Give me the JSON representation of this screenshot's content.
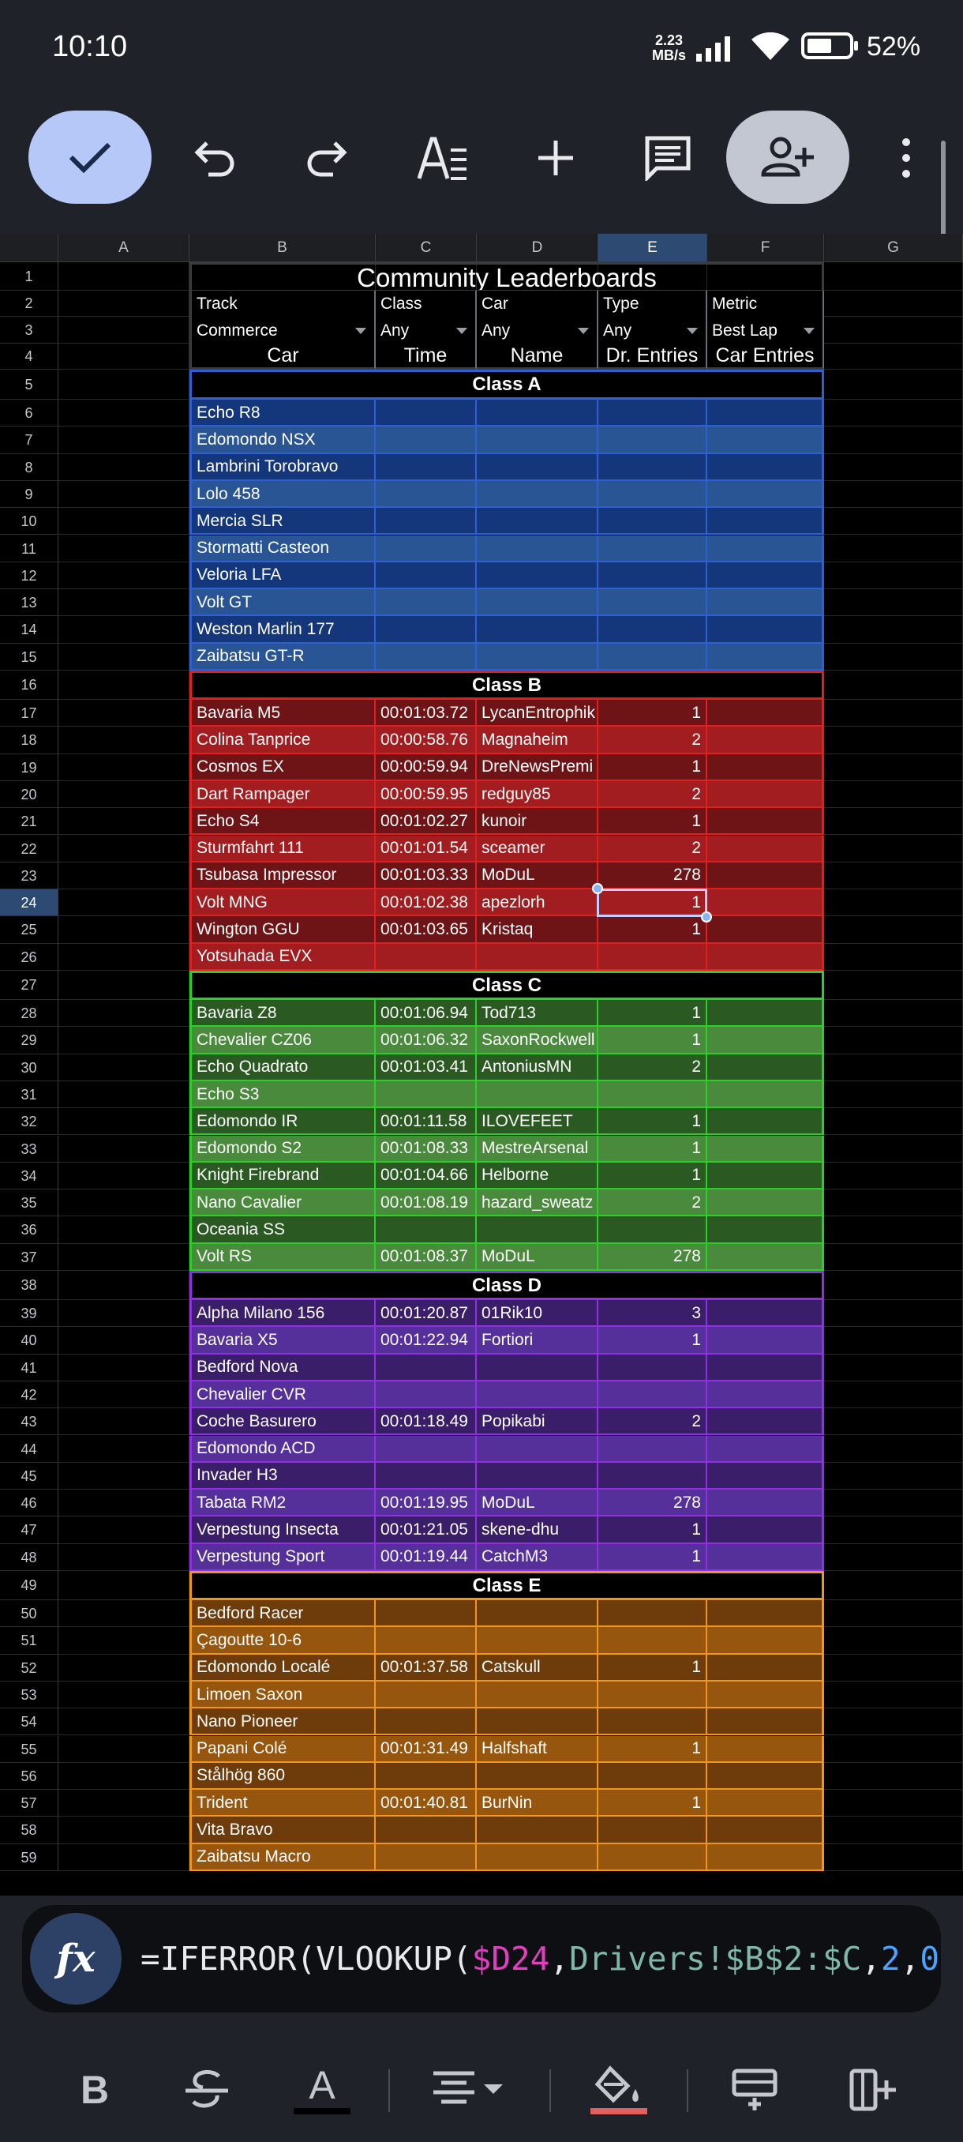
{
  "status_bar": {
    "time": "10:10",
    "net_speed": "2.23",
    "net_unit": "MB/s",
    "battery": "52%"
  },
  "toolbar": {
    "icons": [
      "check-icon",
      "undo-icon",
      "redo-icon",
      "text-format-icon",
      "insert-plus-icon",
      "comment-icon",
      "add-person-icon",
      "more-vert-icon"
    ]
  },
  "columns": [
    "A",
    "B",
    "C",
    "D",
    "E",
    "F",
    "G"
  ],
  "selected_column": "E",
  "selected_row": 24,
  "sheet": {
    "title": "Community Leaderboards",
    "filter_labels": [
      "Track",
      "Class",
      "Car",
      "Type",
      "Metric"
    ],
    "filter_values": [
      "Commerce",
      "Any",
      "Any",
      "Any",
      "Best Lap"
    ],
    "table_headers": [
      "Car",
      "Time",
      "Name",
      "Dr. Entries",
      "Car Entries"
    ],
    "sections": [
      {
        "title": "Class A",
        "border": "#2f5fd0",
        "dark": "#14367a",
        "light": "#2a5594",
        "rows": [
          [
            "Echo R8",
            "",
            "",
            "",
            ""
          ],
          [
            "Edomondo NSX",
            "",
            "",
            "",
            ""
          ],
          [
            "Lambrini Torobravo",
            "",
            "",
            "",
            ""
          ],
          [
            "Lolo 458",
            "",
            "",
            "",
            ""
          ],
          [
            "Mercia SLR",
            "",
            "",
            "",
            ""
          ],
          [
            "Stormatti Casteon",
            "",
            "",
            "",
            ""
          ],
          [
            "Veloria LFA",
            "",
            "",
            "",
            ""
          ],
          [
            "Volt GT",
            "",
            "",
            "",
            ""
          ],
          [
            "Weston Marlin 177",
            "",
            "",
            "",
            ""
          ],
          [
            "Zaibatsu GT-R",
            "",
            "",
            "",
            ""
          ]
        ]
      },
      {
        "title": "Class B",
        "border": "#e02020",
        "dark": "#6e1416",
        "light": "#a11d20",
        "rows": [
          [
            "Bavaria M5",
            "00:01:03.72",
            "LycanEntrophik",
            "1",
            ""
          ],
          [
            "Colina Tanprice",
            "00:00:58.76",
            "Magnaheim",
            "2",
            ""
          ],
          [
            "Cosmos EX",
            "00:00:59.94",
            "DreNewsPremi",
            "1",
            ""
          ],
          [
            "Dart Rampager",
            "00:00:59.95",
            "redguy85",
            "2",
            ""
          ],
          [
            "Echo S4",
            "00:01:02.27",
            "kunoir",
            "1",
            ""
          ],
          [
            "Sturmfahrt 111",
            "00:01:01.54",
            "sceamer",
            "2",
            ""
          ],
          [
            "Tsubasa Impressor",
            "00:01:03.33",
            "MoDuL",
            "278",
            ""
          ],
          [
            "Volt MNG",
            "00:01:02.38",
            "apezlorh",
            "1",
            ""
          ],
          [
            "Wington GGU",
            "00:01:03.65",
            "Kristaq",
            "1",
            ""
          ],
          [
            "Yotsuhada EVX",
            "",
            "",
            "",
            ""
          ]
        ]
      },
      {
        "title": "Class C",
        "border": "#28d028",
        "dark": "#2a5a22",
        "light": "#4a8a3c",
        "rows": [
          [
            "Bavaria Z8",
            "00:01:06.94",
            "Tod713",
            "1",
            ""
          ],
          [
            "Chevalier CZ06",
            "00:01:06.32",
            "SaxonRockwell",
            "1",
            ""
          ],
          [
            "Echo Quadrato",
            "00:01:03.41",
            "AntoniusMN",
            "2",
            ""
          ],
          [
            "Echo S3",
            "",
            "",
            "",
            ""
          ],
          [
            "Edomondo IR",
            "00:01:11.58",
            "ILOVEFEET",
            "1",
            ""
          ],
          [
            "Edomondo S2",
            "00:01:08.33",
            "MestreArsenal",
            "1",
            ""
          ],
          [
            "Knight Firebrand",
            "00:01:04.66",
            "Helborne",
            "1",
            ""
          ],
          [
            "Nano Cavalier",
            "00:01:08.19",
            "hazard_sweatz",
            "2",
            ""
          ],
          [
            "Oceania SS",
            "",
            "",
            "",
            ""
          ],
          [
            "Volt RS",
            "00:01:08.37",
            "MoDuL",
            "278",
            ""
          ]
        ]
      },
      {
        "title": "Class D",
        "border": "#9030e0",
        "dark": "#3a1e6a",
        "light": "#55309a",
        "rows": [
          [
            "Alpha Milano 156",
            "00:01:20.87",
            "01Rik10",
            "3",
            ""
          ],
          [
            "Bavaria X5",
            "00:01:22.94",
            "Fortiori",
            "1",
            ""
          ],
          [
            "Bedford Nova",
            "",
            "",
            "",
            ""
          ],
          [
            "Chevalier CVR",
            "",
            "",
            "",
            ""
          ],
          [
            "Coche Basurero",
            "00:01:18.49",
            "Popikabi",
            "2",
            ""
          ],
          [
            "Edomondo ACD",
            "",
            "",
            "",
            ""
          ],
          [
            "Invader H3",
            "",
            "",
            "",
            ""
          ],
          [
            "Tabata RM2",
            "00:01:19.95",
            "MoDuL",
            "278",
            ""
          ],
          [
            "Verpestung Insecta",
            "00:01:21.05",
            "skene-dhu",
            "1",
            ""
          ],
          [
            "Verpestung Sport",
            "00:01:19.44",
            "CatchM3",
            "1",
            ""
          ]
        ]
      },
      {
        "title": "Class E",
        "border": "#f0961e",
        "dark": "#6e3c0a",
        "light": "#96560e",
        "rows": [
          [
            "Bedford Racer",
            "",
            "",
            "",
            ""
          ],
          [
            "Çagoutte 10-6",
            "",
            "",
            "",
            ""
          ],
          [
            "Edomondo Localé",
            "00:01:37.58",
            "Catskull",
            "1",
            ""
          ],
          [
            "Limoen Saxon",
            "",
            "",
            "",
            ""
          ],
          [
            "Nano Pioneer",
            "",
            "",
            "",
            ""
          ],
          [
            "Papani Colé",
            "00:01:31.49",
            "Halfshaft",
            "1",
            ""
          ],
          [
            "Stålhög 860",
            "",
            "",
            "",
            ""
          ],
          [
            "Trident",
            "00:01:40.81",
            "BurNin",
            "1",
            ""
          ],
          [
            "Vita Bravo",
            "",
            "",
            "",
            ""
          ],
          [
            "Zaibatsu Macro",
            "",
            "",
            "",
            ""
          ]
        ]
      }
    ]
  },
  "formula_bar": {
    "fx_label": "fx",
    "parts": [
      {
        "text": "=IFERROR(VLOOKUP(",
        "color": "#e8eaed"
      },
      {
        "text": "$D24",
        "color": "#e040c0"
      },
      {
        "text": ",",
        "color": "#e8eaed"
      },
      {
        "text": "Drivers!$B$2:$C",
        "color": "#7fb8a8"
      },
      {
        "text": ",",
        "color": "#e8eaed"
      },
      {
        "text": "2",
        "color": "#4aa3ff"
      },
      {
        "text": ",",
        "color": "#e8eaed"
      },
      {
        "text": "0",
        "color": "#4aa3ff"
      }
    ]
  },
  "format_bar": {
    "icons": [
      "bold-icon",
      "strikethrough-icon",
      "text-color-icon",
      "align-icon",
      "fill-color-icon",
      "insert-row-icon",
      "insert-column-icon"
    ],
    "bold_label": "B",
    "text_color_label": "A"
  }
}
